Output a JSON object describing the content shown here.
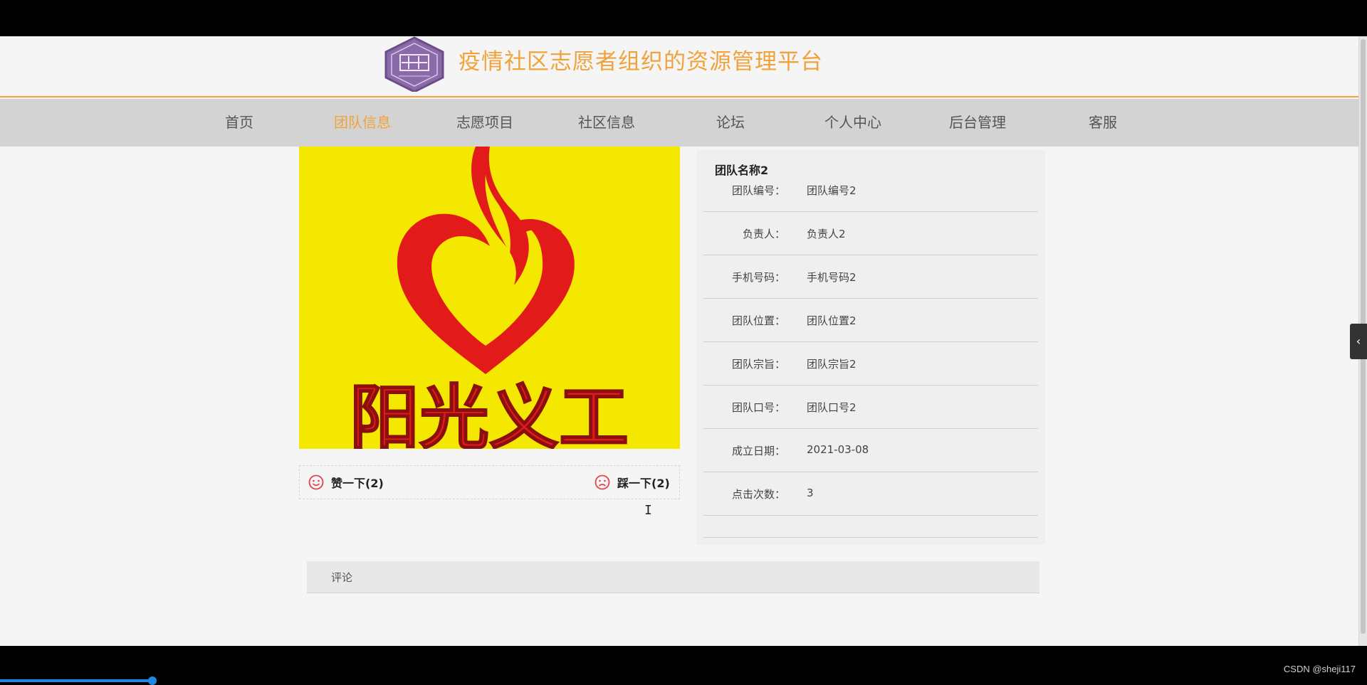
{
  "site": {
    "title": "疫情社区志愿者组织的资源管理平台",
    "logo_icon": "seal-logo-icon",
    "accent_color": "#f0a33a"
  },
  "nav": {
    "items": [
      {
        "label": "首页",
        "active": false
      },
      {
        "label": "团队信息",
        "active": true
      },
      {
        "label": "志愿项目",
        "active": false
      },
      {
        "label": "社区信息",
        "active": false
      },
      {
        "label": "论坛",
        "active": false
      },
      {
        "label": "个人中心",
        "active": false
      },
      {
        "label": "后台管理",
        "active": false
      },
      {
        "label": "客服",
        "active": false
      }
    ]
  },
  "team_image": {
    "caption": "阳光义工"
  },
  "votes": {
    "like_label": "赞一下(2)",
    "dislike_label": "踩一下(2)"
  },
  "details": {
    "title": "团队名称2",
    "rows": [
      {
        "label": "团队编号：",
        "value": "团队编号2"
      },
      {
        "label": "负责人：",
        "value": "负责人2"
      },
      {
        "label": "手机号码：",
        "value": "手机号码2"
      },
      {
        "label": "团队位置：",
        "value": "团队位置2"
      },
      {
        "label": "团队宗旨：",
        "value": "团队宗旨2"
      },
      {
        "label": "团队口号：",
        "value": "团队口号2"
      },
      {
        "label": "成立日期：",
        "value": "2021-03-08"
      },
      {
        "label": "点击次数：",
        "value": "3"
      }
    ]
  },
  "comments": {
    "tab_label": "评论"
  },
  "side_toggle": {
    "icon": "chevron-left-icon",
    "glyph": "‹"
  },
  "watermark": "CSDN @sheji117"
}
